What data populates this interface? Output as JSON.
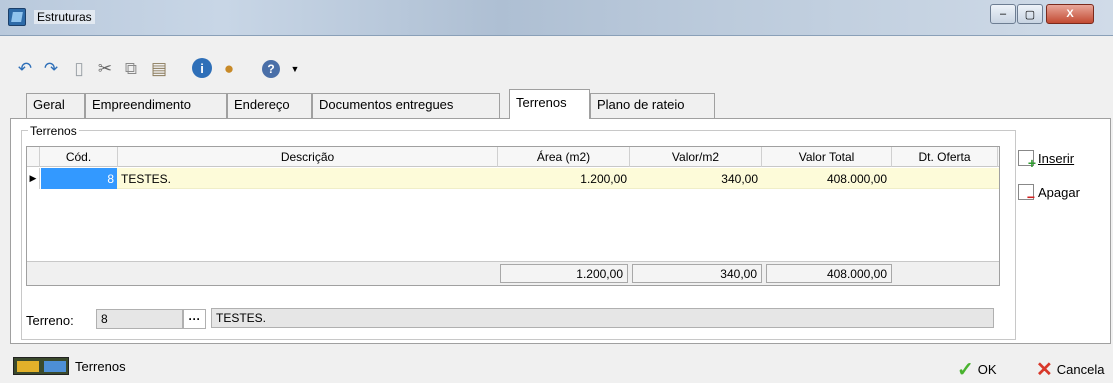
{
  "window": {
    "title": "Estruturas",
    "min": "–",
    "max": "▢",
    "close": "X"
  },
  "tabs": [
    {
      "label": "Geral"
    },
    {
      "label": "Empreendimento"
    },
    {
      "label": "Endereço"
    },
    {
      "label": "Documentos entregues"
    },
    {
      "label": "Terrenos"
    },
    {
      "label": "Plano de rateio"
    }
  ],
  "group": {
    "label": "Terrenos"
  },
  "grid": {
    "columns": [
      "Cód.",
      "Descrição",
      "Área (m2)",
      "Valor/m2",
      "Valor Total",
      "Dt. Oferta"
    ],
    "rows": [
      {
        "codigo": "8",
        "descricao": "TESTES.",
        "area": "1.200,00",
        "valor_m2": "340,00",
        "valor_total": "408.000,00",
        "dt_oferta": ""
      }
    ],
    "totals": {
      "area": "1.200,00",
      "valor_m2": "340,00",
      "valor_total": "408.000,00"
    }
  },
  "actions": {
    "insert": "Inserir",
    "delete": "Apagar"
  },
  "terreno_field": {
    "label": "Terreno:",
    "code": "8",
    "lookup": "···",
    "description": "TESTES."
  },
  "status": {
    "label": "Terrenos"
  },
  "buttons": {
    "ok": "OK",
    "cancel": "Cancela"
  },
  "toolbar_icons": [
    "undo-icon",
    "redo-icon",
    "new-document-icon",
    "cut-icon",
    "copy-icon",
    "paste-icon",
    "info-icon",
    "user-icon",
    "help-icon",
    "dropdown-arrow-icon"
  ]
}
